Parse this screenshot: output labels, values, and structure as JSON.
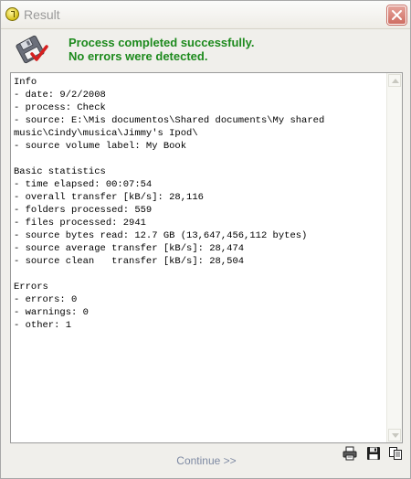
{
  "window": {
    "title": "Result"
  },
  "header": {
    "line1": "Process completed successfully.",
    "line2": "No errors were detected."
  },
  "log": {
    "text": "Info\n- date: 9/2/2008\n- process: Check\n- source: E:\\Mis documentos\\Shared documents\\My shared music\\Cindy\\musica\\Jimmy's Ipod\\\n- source volume label: My Book\n\nBasic statistics\n- time elapsed: 00:07:54\n- overall transfer [kB/s]: 28,116\n- folders processed: 559\n- files processed: 2941\n- source bytes read: 12.7 GB (13,647,456,112 bytes)\n- source average transfer [kB/s]: 28,474\n- source clean   transfer [kB/s]: 28,504\n\nErrors\n- errors: 0\n- warnings: 0\n- other: 1"
  },
  "footer": {
    "continue_label": "Continue >>"
  },
  "icons": {
    "title": "status-icon",
    "header": "floppy-check-icon",
    "toolbar": [
      "printer-icon",
      "save-icon",
      "copy-icon"
    ]
  },
  "colors": {
    "message": "#1d8a1d",
    "continue_link": "#7e8aa3",
    "close_button": "#cf6e63"
  }
}
